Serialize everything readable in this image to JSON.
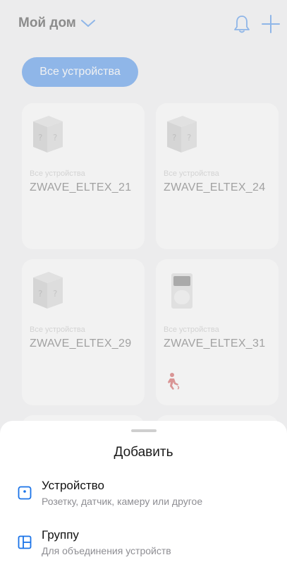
{
  "header": {
    "home_title": "Мой дом"
  },
  "filter": {
    "chip_label": "Все устройства"
  },
  "devices": [
    {
      "category": "Все устройства",
      "name": "ZWAVE_ELTEX_21",
      "image": "unknown-cube-icon"
    },
    {
      "category": "Все устройства",
      "name": "ZWAVE_ELTEX_24",
      "image": "unknown-cube-icon"
    },
    {
      "category": "Все устройства",
      "name": "ZWAVE_ELTEX_29",
      "image": "unknown-cube-icon"
    },
    {
      "category": "Все устройства",
      "name": "ZWAVE_ELTEX_31",
      "image": "motion-sensor-icon",
      "status_icon": "motion-detected-icon"
    }
  ],
  "sheet": {
    "title": "Добавить",
    "options": [
      {
        "title": "Устройство",
        "subtitle": "Розетку, датчик, камеру или другое",
        "icon": "device-icon"
      },
      {
        "title": "Группу",
        "subtitle": "Для объединения устройств",
        "icon": "group-icon"
      }
    ]
  },
  "colors": {
    "accent": "#1a73e8",
    "motion_alert": "#c62828"
  }
}
